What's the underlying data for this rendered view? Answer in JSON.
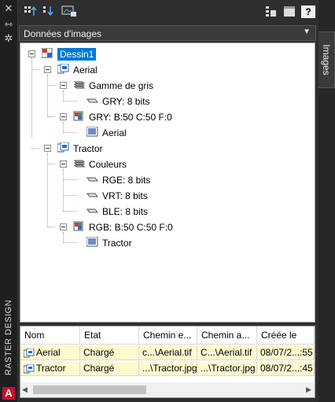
{
  "palette": {
    "accent": "#0078d7",
    "row_highlight": "#fdfad0",
    "logo_red": "#c8102e"
  },
  "left_strip": {
    "icons": [
      "close-icon",
      "auto-hide-icon",
      "settings-icon"
    ],
    "title": "RASTER DESIGN",
    "logo": "A"
  },
  "toolbar": {
    "left_buttons": [
      "sort-up-icon",
      "sort-down-icon",
      "image-insert-icon"
    ],
    "right_buttons": [
      "details-view-icon",
      "preview-icon",
      "help-icon"
    ],
    "help_label": "?"
  },
  "view_selector": {
    "value": "Données d'images"
  },
  "side_tab": {
    "label": "Images"
  },
  "tree": {
    "nodes": [
      {
        "label": "Dessin1"
      },
      {
        "label": "Aerial"
      },
      {
        "label": "Gamme de gris"
      },
      {
        "label": "GRY: 8 bits"
      },
      {
        "label": "GRY: B:50 C:50 F:0"
      },
      {
        "label": "Aerial"
      },
      {
        "label": "Tractor"
      },
      {
        "label": "Couleurs"
      },
      {
        "label": "RGE: 8 bits"
      },
      {
        "label": "VRT: 8 bits"
      },
      {
        "label": "BLE: 8 bits"
      },
      {
        "label": "RGB: B:50 C:50 F:0"
      },
      {
        "label": "Tractor"
      }
    ]
  },
  "table": {
    "columns": [
      "Nom",
      "Etat",
      "Chemin e...",
      "Chemin a...",
      "Créée le"
    ],
    "rows": [
      {
        "name": "Aerial",
        "state": "Chargé",
        "path1": "c...\\Aerial.tif",
        "path2": "C...\\Aerial.tif",
        "created": "08/07/2...:55"
      },
      {
        "name": "Tractor",
        "state": "Chargé",
        "path1": "...\\Tractor.jpg",
        "path2": "...\\Tractor.jpg",
        "created": "08/07/2...:45"
      }
    ]
  }
}
